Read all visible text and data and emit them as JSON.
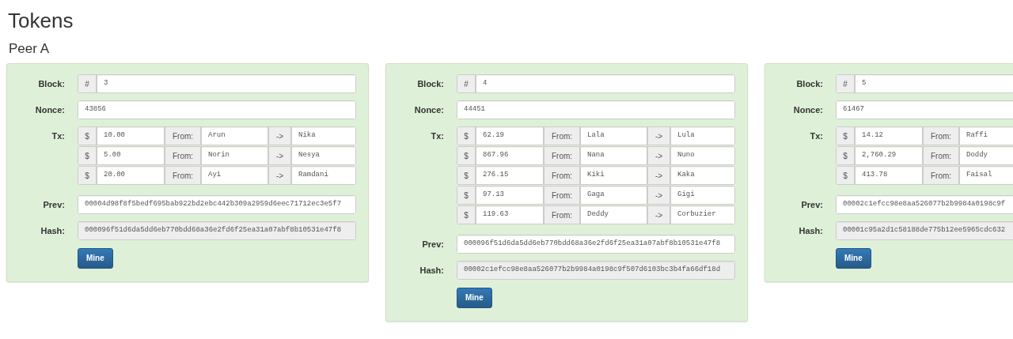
{
  "title": "Tokens",
  "peer": "Peer A",
  "blocks": [
    {
      "block_label": "Block:",
      "hash_sign": "#",
      "block": "3",
      "nonce_label": "Nonce:",
      "nonce": "43856",
      "tx_label": "Tx:",
      "txs": [
        {
          "currency": "$",
          "amount": "10.00",
          "from_label": "From:",
          "from": "Arun",
          "arrow": "->",
          "to": "Nika"
        },
        {
          "currency": "$",
          "amount": "5.00",
          "from_label": "From:",
          "from": "Norin",
          "arrow": "->",
          "to": "Nesya"
        },
        {
          "currency": "$",
          "amount": "20.00",
          "from_label": "From:",
          "from": "Ayi",
          "arrow": "->",
          "to": "Ramdani"
        }
      ],
      "prev_label": "Prev:",
      "prev": "00004d98f8f5bedf695bab922bd2ebc442b309a2959d6eec71712ec3e5f7",
      "hash_label": "Hash:",
      "hash": "000096f51d6da5dd6eb770bdd68a36e2fd6f25ea31a07abf8b10531e47f8",
      "button": "Mine"
    },
    {
      "block_label": "Block:",
      "hash_sign": "#",
      "block": "4",
      "nonce_label": "Nonce:",
      "nonce": "44451",
      "tx_label": "Tx:",
      "txs": [
        {
          "currency": "$",
          "amount": "62.19",
          "from_label": "From:",
          "from": "Lala",
          "arrow": "->",
          "to": "Lula"
        },
        {
          "currency": "$",
          "amount": "867.96",
          "from_label": "From:",
          "from": "Nana",
          "arrow": "->",
          "to": "Nuno"
        },
        {
          "currency": "$",
          "amount": "276.15",
          "from_label": "From:",
          "from": "Kiki",
          "arrow": "->",
          "to": "Kaka"
        },
        {
          "currency": "$",
          "amount": "97.13",
          "from_label": "From:",
          "from": "Gaga",
          "arrow": "->",
          "to": "Gigi"
        },
        {
          "currency": "$",
          "amount": "119.63",
          "from_label": "From:",
          "from": "Deddy",
          "arrow": "->",
          "to": "Corbuzier"
        }
      ],
      "prev_label": "Prev:",
      "prev": "000096f51d6da5dd6eb770bdd68a36e2fd6f25ea31a07abf8b10531e47f8",
      "hash_label": "Hash:",
      "hash": "00002c1efcc98e8aa526077b2b9984a0198c9f507d6103bc3b4fa66df18d",
      "button": "Mine"
    },
    {
      "block_label": "Block:",
      "hash_sign": "#",
      "block": "5",
      "nonce_label": "Nonce:",
      "nonce": "61467",
      "tx_label": "Tx:",
      "txs": [
        {
          "currency": "$",
          "amount": "14.12",
          "from_label": "From:",
          "from": "Raffi"
        },
        {
          "currency": "$",
          "amount": "2,760.29",
          "from_label": "From:",
          "from": "Doddy"
        },
        {
          "currency": "$",
          "amount": "413.78",
          "from_label": "From:",
          "from": "Faisal"
        }
      ],
      "prev_label": "Prev:",
      "prev": "00002c1efcc98e8aa526077b2b9984a0198c9f",
      "hash_label": "Hash:",
      "hash": "00001c95a2d1c58188de775b12ee5965cdc632",
      "button": "Mine"
    }
  ]
}
